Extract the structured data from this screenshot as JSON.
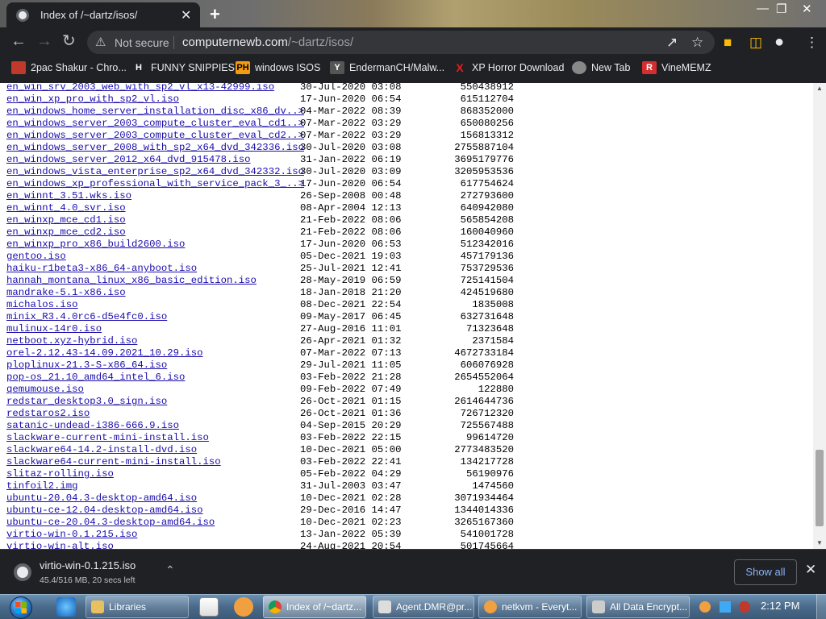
{
  "browser": {
    "tab_title": "Index of /~dartz/isos/",
    "tab_close": "✕",
    "new_tab": "+",
    "security_label": "Not secure",
    "url_domain": "computernewb.com",
    "url_path": "/~dartz/isos/"
  },
  "bookmarks": [
    {
      "label": "2pac Shakur - Chro...",
      "icon_text": "",
      "icon_color": "#c0392b"
    },
    {
      "label": "FUNNY SNIPPIES",
      "icon_text": "H",
      "icon_color": "#ffffff"
    },
    {
      "label": "windows ISOS",
      "icon_text": "PH",
      "icon_color": "#f39c12"
    },
    {
      "label": "EndermanCH/Malw...",
      "icon_text": "Y",
      "icon_color": "#555555"
    },
    {
      "label": "XP Horror Download",
      "icon_text": "X",
      "icon_color": "#e02020"
    },
    {
      "label": "New Tab",
      "icon_text": "",
      "icon_color": "#888888"
    },
    {
      "label": "VineMEMZ",
      "icon_text": "R",
      "icon_color": "#d32f2f"
    }
  ],
  "files": [
    {
      "name": "en_win_srv_2003_web_with_sp2_vl_x13-42999.iso",
      "date": "30-Jul-2020 03:08",
      "size": "550438912"
    },
    {
      "name": "en_win_xp_pro_with_sp2_vl.iso",
      "date": "17-Jun-2020 06:54",
      "size": "615112704"
    },
    {
      "name": "en_windows_home_server_installation_disc_x86_dv..>",
      "date": "04-Mar-2022 08:39",
      "size": "868352000"
    },
    {
      "name": "en_windows_server_2003_compute_cluster_eval_cd1..>",
      "date": "07-Mar-2022 03:29",
      "size": "650080256"
    },
    {
      "name": "en_windows_server_2003_compute_cluster_eval_cd2..>",
      "date": "07-Mar-2022 03:29",
      "size": "156813312"
    },
    {
      "name": "en_windows_server_2008_with_sp2_x64_dvd_342336.iso",
      "date": "30-Jul-2020 03:08",
      "size": "2755887104"
    },
    {
      "name": "en_windows_server_2012_x64_dvd_915478.iso",
      "date": "31-Jan-2022 06:19",
      "size": "3695179776"
    },
    {
      "name": "en_windows_vista_enterprise_sp2_x64_dvd_342332.iso",
      "date": "30-Jul-2020 03:09",
      "size": "3205953536"
    },
    {
      "name": "en_windows_xp_professional_with_service_pack_3_..>",
      "date": "17-Jun-2020 06:54",
      "size": "617754624"
    },
    {
      "name": "en_winnt_3.51.wks.iso",
      "date": "26-Sep-2008 00:48",
      "size": "272793600"
    },
    {
      "name": "en_winnt_4.0_svr.iso",
      "date": "08-Apr-2004 12:13",
      "size": "640942080"
    },
    {
      "name": "en_winxp_mce_cd1.iso",
      "date": "21-Feb-2022 08:06",
      "size": "565854208"
    },
    {
      "name": "en_winxp_mce_cd2.iso",
      "date": "21-Feb-2022 08:06",
      "size": "160040960"
    },
    {
      "name": "en_winxp_pro_x86_build2600.iso",
      "date": "17-Jun-2020 06:53",
      "size": "512342016"
    },
    {
      "name": "gentoo.iso",
      "date": "05-Dec-2021 19:03",
      "size": "457179136"
    },
    {
      "name": "haiku-r1beta3-x86_64-anyboot.iso",
      "date": "25-Jul-2021 12:41",
      "size": "753729536"
    },
    {
      "name": "hannah_montana_linux_x86_basic_edition.iso",
      "date": "28-May-2019 06:59",
      "size": "725141504"
    },
    {
      "name": "mandrake-5.1-x86.iso",
      "date": "18-Jan-2018 21:20",
      "size": "424519680"
    },
    {
      "name": "michalos.iso",
      "date": "08-Dec-2021 22:54",
      "size": "1835008"
    },
    {
      "name": "minix_R3.4.0rc6-d5e4fc0.iso",
      "date": "09-May-2017 06:45",
      "size": "632731648"
    },
    {
      "name": "mulinux-14r0.iso",
      "date": "27-Aug-2016 11:01",
      "size": "71323648"
    },
    {
      "name": "netboot.xyz-hybrid.iso",
      "date": "26-Apr-2021 01:32",
      "size": "2371584"
    },
    {
      "name": "orel-2.12.43-14.09.2021_10.29.iso",
      "date": "07-Mar-2022 07:13",
      "size": "4672733184"
    },
    {
      "name": "ploplinux-21.3-S-x86_64.iso",
      "date": "29-Jul-2021 11:05",
      "size": "606076928"
    },
    {
      "name": "pop-os_21.10_amd64_intel_6.iso",
      "date": "03-Feb-2022 21:28",
      "size": "2654552064"
    },
    {
      "name": "qemumouse.iso",
      "date": "09-Feb-2022 07:49",
      "size": "122880"
    },
    {
      "name": "redstar_desktop3.0_sign.iso",
      "date": "26-Oct-2021 01:15",
      "size": "2614644736"
    },
    {
      "name": "redstaros2.iso",
      "date": "26-Oct-2021 01:36",
      "size": "726712320"
    },
    {
      "name": "satanic-undead-i386-666.9.iso",
      "date": "04-Sep-2015 20:29",
      "size": "725567488"
    },
    {
      "name": "slackware-current-mini-install.iso",
      "date": "03-Feb-2022 22:15",
      "size": "99614720"
    },
    {
      "name": "slackware64-14.2-install-dvd.iso",
      "date": "10-Dec-2021 05:00",
      "size": "2773483520"
    },
    {
      "name": "slackware64-current-mini-install.iso",
      "date": "03-Feb-2022 22:41",
      "size": "134217728"
    },
    {
      "name": "slitaz-rolling.iso",
      "date": "05-Feb-2022 04:29",
      "size": "56190976"
    },
    {
      "name": "tinfoil2.img",
      "date": "31-Jul-2003 03:47",
      "size": "1474560"
    },
    {
      "name": "ubuntu-20.04.3-desktop-amd64.iso",
      "date": "10-Dec-2021 02:28",
      "size": "3071934464"
    },
    {
      "name": "ubuntu-ce-12.04-desktop-amd64.iso",
      "date": "29-Dec-2016 14:47",
      "size": "1344014336"
    },
    {
      "name": "ubuntu-ce-20.04.3-desktop-amd64.iso",
      "date": "10-Dec-2021 02:23",
      "size": "3265167360"
    },
    {
      "name": "virtio-win-0.1.215.iso",
      "date": "13-Jan-2022 05:39",
      "size": "541001728"
    },
    {
      "name": "virtio-win-alt.iso",
      "date": "24-Aug-2021 20:54",
      "size": "501745664"
    }
  ],
  "download": {
    "filename": "virtio-win-0.1.215.iso",
    "status": "45.4/516 MB, 20 secs left",
    "show_all": "Show all"
  },
  "taskbar": {
    "items": [
      {
        "label": "Libraries",
        "icon_color": "#e8c060",
        "active": false
      },
      {
        "label": "Index of /~dartz...",
        "icon_color": "#4caf50",
        "active": true
      },
      {
        "label": "Agent.DMR@pr...",
        "icon_color": "#dddddd",
        "active": false
      },
      {
        "label": "netkvm - Everyt...",
        "icon_color": "#f0a040",
        "active": false
      },
      {
        "label": "All Data Encrypt...",
        "icon_color": "#cccccc",
        "active": false
      }
    ],
    "clock": "2:12 PM"
  }
}
